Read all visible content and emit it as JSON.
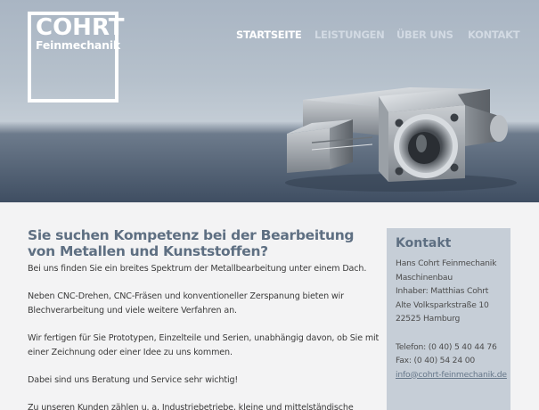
{
  "logo": {
    "title": "COHRT",
    "subtitle": "Feinmechanik"
  },
  "nav": {
    "items": [
      {
        "label": "STARTSEITE",
        "active": true
      },
      {
        "label": "LEISTUNGEN",
        "active": false
      },
      {
        "label": "ÜBER UNS",
        "active": false
      },
      {
        "label": "KONTAKT",
        "active": false
      }
    ]
  },
  "main": {
    "headline": "Sie suchen Kompetenz bei der Bearbeitung von Metallen und Kunststoffen?",
    "paragraphs": [
      "Bei uns finden Sie ein breites Spektrum der Metallbearbeitung unter einem Dach.",
      "Neben CNC-Drehen, CNC-Fräsen und konventioneller Zerspanung bieten wir Blechverarbeitung und viele weitere Verfahren an.",
      "Wir fertigen für Sie Prototypen, Einzelteile und Serien, unabhängig davon, ob Sie mit einer Zeichnung oder einer Idee zu uns kommen.",
      "Dabei sind uns Beratung und Service sehr wichtig!",
      "Zu unseren Kunden zählen u. a. Industriebetriebe, kleine und mittelständische Unternehmen:"
    ]
  },
  "contact": {
    "title": "Kontakt",
    "company": "Hans Cohrt Feinmechanik",
    "type": "Maschinenbau",
    "owner": "Inhaber: Matthias Cohrt",
    "street": "Alte Volksparkstraße 10",
    "city": "22525 Hamburg",
    "phone": "Telefon: (0 40) 5 40 44 76",
    "fax": "Fax: (0 40) 54 24 00",
    "email": "info@cohrt-feinmechanik.de"
  },
  "colors": {
    "accent": "#5e6f82",
    "hero_top": "#a9b5c3",
    "hero_bottom": "#3f4e62",
    "contact_bg": "#c6ced7"
  }
}
